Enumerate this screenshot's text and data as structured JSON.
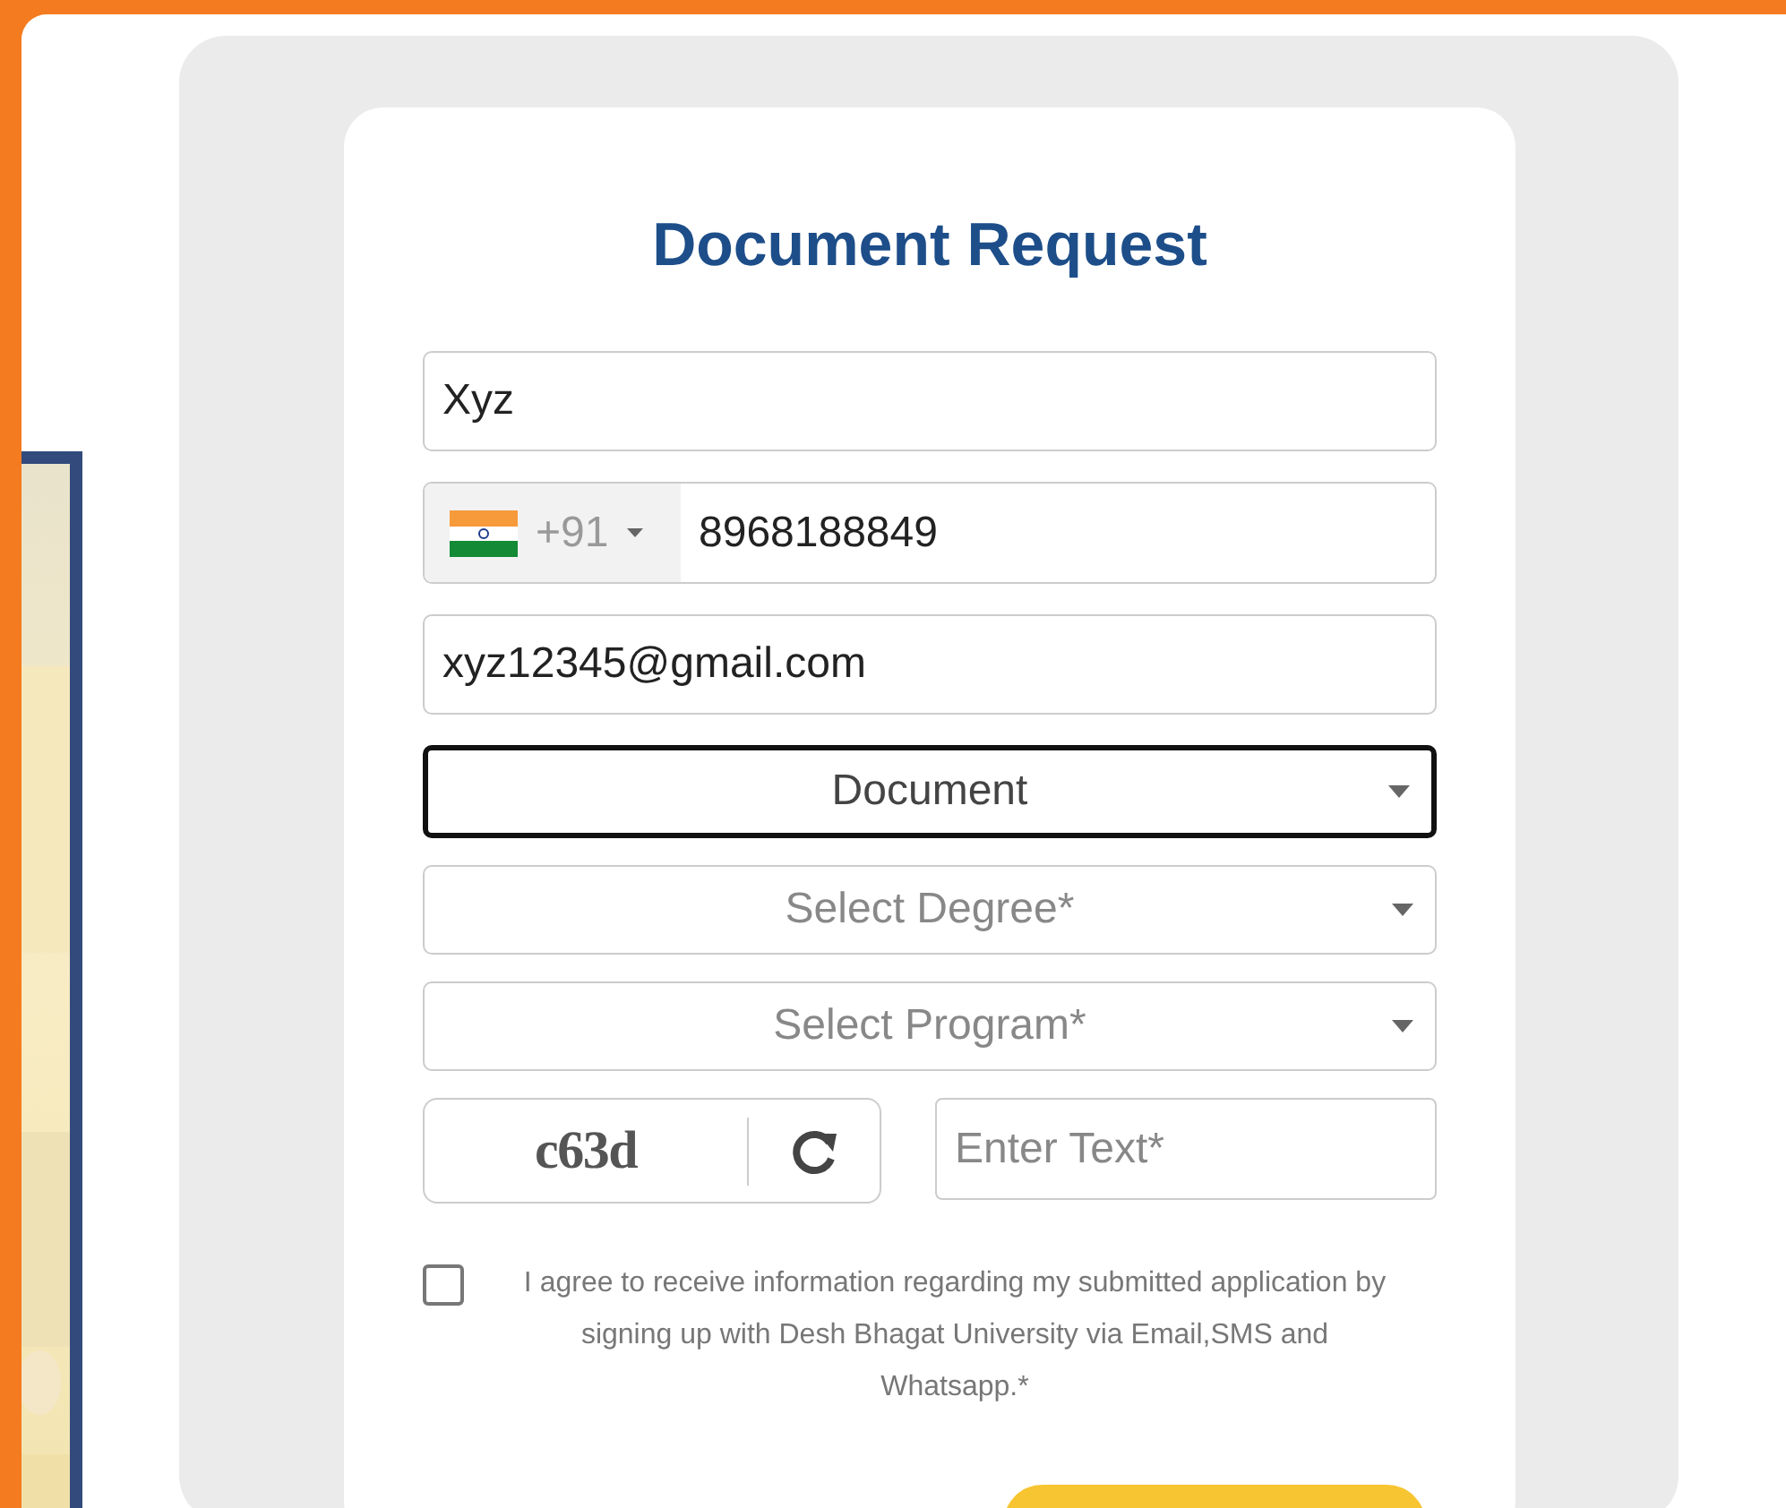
{
  "form": {
    "title": "Document Request",
    "fields": [
      {
        "kind": "text",
        "value": "Xyz"
      },
      {
        "kind": "phone",
        "country_code": "+91",
        "value": "8968188849"
      },
      {
        "kind": "text",
        "value": "xyz12345@gmail.com"
      },
      {
        "kind": "select",
        "value": "Document",
        "focused": true
      },
      {
        "kind": "select",
        "placeholder": "Select Degree*",
        "focused": false
      },
      {
        "kind": "select",
        "placeholder": "Select Program*",
        "focused": false
      }
    ],
    "captcha": {
      "code": "c63d",
      "placeholder": "Enter Text*"
    },
    "consent": {
      "checked": false,
      "text": "I agree to receive information regarding my submitted application by signing up with Desh Bhagat University via Email,SMS and Whatsapp.*"
    }
  }
}
